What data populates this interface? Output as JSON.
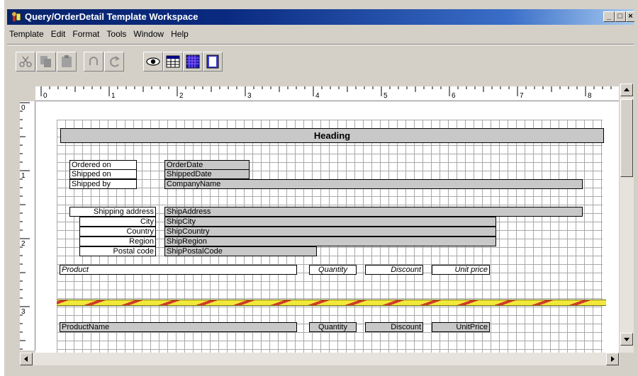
{
  "window": {
    "title": "Query/OrderDetail Template Workspace"
  },
  "menu": [
    "Template",
    "Edit",
    "Format",
    "Tools",
    "Window",
    "Help"
  ],
  "toolbar": {
    "buttons": [
      "cut-icon",
      "copy-icon",
      "paste-icon",
      "undo-icon",
      "redo-icon",
      "preview-eye-icon",
      "grid-view-icon",
      "color-grid-icon",
      "page-layout-icon"
    ]
  },
  "ruler": {
    "h_labels": [
      "0",
      "1",
      "2",
      "3",
      "4",
      "5",
      "6",
      "7",
      "8"
    ],
    "v_labels": [
      "0",
      "1",
      "2",
      "3"
    ]
  },
  "template": {
    "heading": "Heading",
    "order_labels": [
      "Ordered on",
      "Shipped on",
      "Shipped by"
    ],
    "order_fields": [
      "OrderDate",
      "ShippedDate",
      "CompanyName"
    ],
    "ship_labels": [
      "Shipping address",
      "City",
      "Country",
      "Region",
      "Postal code"
    ],
    "ship_fields": [
      "ShipAddress",
      "ShipCity",
      "ShipCountry",
      "ShipRegion",
      "ShipPostalCode"
    ],
    "col_headers": [
      "Product",
      "Quantity",
      "Discount",
      "Unit price"
    ],
    "detail_fields": [
      "ProductName",
      "Quantity",
      "Discount",
      "UnitPrice"
    ]
  },
  "colors": {
    "title_start": "#08246b",
    "title_end": "#a6caf0",
    "field_gray": "#c8c8c8",
    "band_yellow": "#f2e83a",
    "band_red": "#d23a2a"
  }
}
